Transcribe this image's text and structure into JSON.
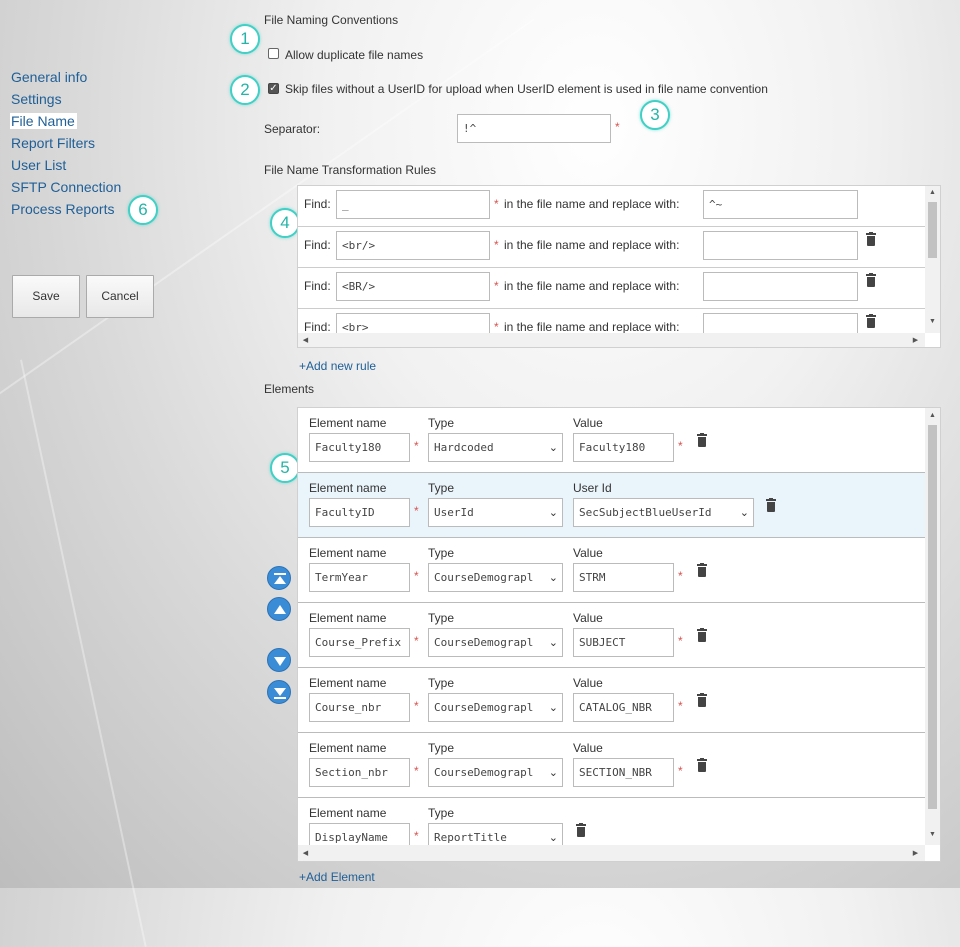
{
  "nav": {
    "items": [
      "General info",
      "Settings",
      "File Name",
      "Report Filters",
      "User List",
      "SFTP Connection",
      "Process Reports"
    ],
    "active_index": 2
  },
  "buttons": {
    "save": "Save",
    "cancel": "Cancel"
  },
  "callouts": [
    "1",
    "2",
    "3",
    "4",
    "5",
    "6"
  ],
  "file_naming": {
    "title": "File Naming Conventions",
    "allow_duplicates_label": "Allow duplicate file names",
    "allow_duplicates_checked": false,
    "skip_files_label": "Skip files without a UserID for upload when UserID element is used in file name convention",
    "skip_files_checked": true,
    "separator_label": "Separator:",
    "separator_value": "!^",
    "required_mark": "*"
  },
  "rules": {
    "title": "File Name Transformation Rules",
    "find_label": "Find:",
    "replace_label": "in the file name and replace with:",
    "items": [
      {
        "find": "_",
        "replace": "^~",
        "deletable": false
      },
      {
        "find": "<br/>",
        "replace": "",
        "deletable": true
      },
      {
        "find": "<BR/>",
        "replace": "",
        "deletable": true
      },
      {
        "find": "<br>",
        "replace": "",
        "deletable": true
      }
    ],
    "add_label": "+Add new rule"
  },
  "elements": {
    "title": "Elements",
    "name_header": "Element name",
    "type_header": "Type",
    "items": [
      {
        "name": "Faculty180",
        "type": "Hardcoded",
        "value_header": "Value",
        "value": "Faculty180",
        "value_is_select": false
      },
      {
        "name": "FacultyID",
        "type": "UserId",
        "value_header": "User Id",
        "value": "SecSubjectBlueUserId",
        "value_is_select": true
      },
      {
        "name": "TermYear",
        "type": "CourseDemograpl",
        "value_header": "Value",
        "value": "STRM",
        "value_is_select": false
      },
      {
        "name": "Course_Prefix",
        "type": "CourseDemograpl",
        "value_header": "Value",
        "value": "SUBJECT",
        "value_is_select": false
      },
      {
        "name": "Course_nbr",
        "type": "CourseDemograpl",
        "value_header": "Value",
        "value": "CATALOG_NBR",
        "value_is_select": false
      },
      {
        "name": "Section_nbr",
        "type": "CourseDemograpl",
        "value_header": "Value",
        "value": "SECTION_NBR",
        "value_is_select": false
      },
      {
        "name": "DisplayName",
        "type": "ReportTitle",
        "value_header": "",
        "value": "",
        "value_is_select": false
      }
    ],
    "add_label": "+Add Element"
  },
  "colors": {
    "link": "#1f5f97",
    "callout_border": "#40d0c5",
    "required": "#d9534f",
    "highlight_row": "#eaf4fb",
    "move_button": "#3b8cd6"
  },
  "icons": {
    "trash": "trash-icon",
    "move_top": "move-to-top-icon",
    "move_up": "move-up-icon",
    "move_down": "move-down-icon",
    "move_bottom": "move-to-bottom-icon"
  }
}
